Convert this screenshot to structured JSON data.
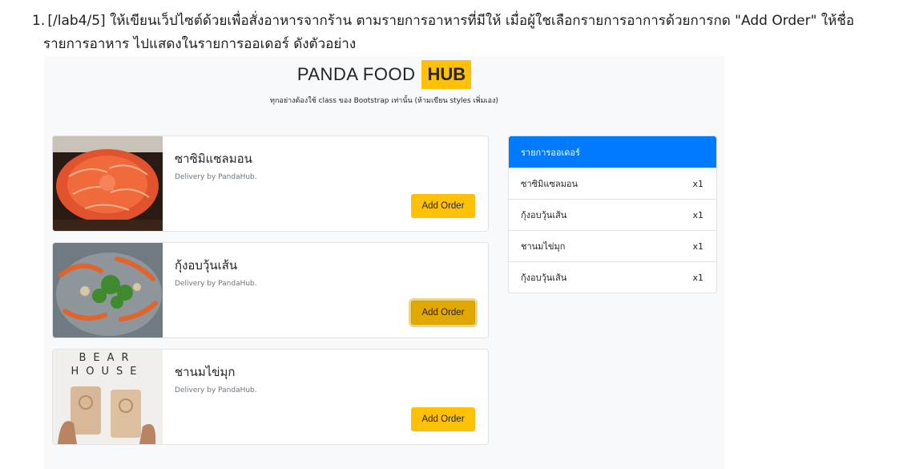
{
  "instruction": {
    "number": "1.",
    "line1": "[/lab4/5] ให้เขียนเว็ปไซต์ด้วยเพื่อสั่งอาหารจากร้าน ตามรายการอาหารที่มีให้ เมื่อผู้ใชเลือกรายการอาการด้วยการกด \"Add Order\" ให้ชื่อ",
    "line2": "รายการอาหาร ไปแสดงในรายการออเดอร์ ดังตัวอย่าง"
  },
  "header": {
    "brand": "PANDA FOOD",
    "brand_highlight": "HUB",
    "subtitle": "ทุกอย่างต้องใช้ class ของ Bootstrap เท่านั้น (ห้ามเขียน styles เพิ่มเอง)"
  },
  "menu": [
    {
      "name": "ซาซิมิแซลมอน",
      "meta": "Delivery by PandaHub.",
      "button": "Add Order"
    },
    {
      "name": "กุ้งอบวุ้นเส้น",
      "meta": "Delivery by PandaHub.",
      "button": "Add Order"
    },
    {
      "name": "ชานมไข่มุก",
      "meta": "Delivery by PandaHub.",
      "button": "Add Order",
      "image_text_1": "BEAR",
      "image_text_2": "HOUSE"
    }
  ],
  "orders": {
    "heading": "รายการออเดอร์",
    "items": [
      {
        "name": "ซาซิมิแซลมอน",
        "qty": "x1"
      },
      {
        "name": "กุ้งอบวุ้นเส้น",
        "qty": "x1"
      },
      {
        "name": "ชานมไข่มุก",
        "qty": "x1"
      },
      {
        "name": "กุ้งอบวุ้นเส้น",
        "qty": "x1"
      }
    ]
  },
  "colors": {
    "accent_yellow": "#ffc107",
    "primary_blue": "#007bff",
    "page_bg": "#f8f9fa"
  }
}
